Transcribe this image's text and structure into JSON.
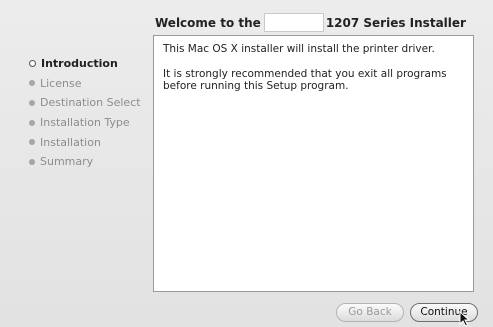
{
  "title": {
    "prefix": "Welcome to the",
    "suffix": "1207 Series Installer"
  },
  "sidebar": {
    "items": [
      {
        "label": "Introduction",
        "active": true
      },
      {
        "label": "License",
        "active": false
      },
      {
        "label": "Destination Select",
        "active": false
      },
      {
        "label": "Installation Type",
        "active": false
      },
      {
        "label": "Installation",
        "active": false
      },
      {
        "label": "Summary",
        "active": false
      }
    ]
  },
  "content": {
    "paragraphs": [
      "This Mac OS X installer will install the printer driver.",
      "It is strongly recommended that you exit all programs before running this Setup program."
    ]
  },
  "buttons": {
    "go_back": "Go Back",
    "continue": "Continue"
  }
}
